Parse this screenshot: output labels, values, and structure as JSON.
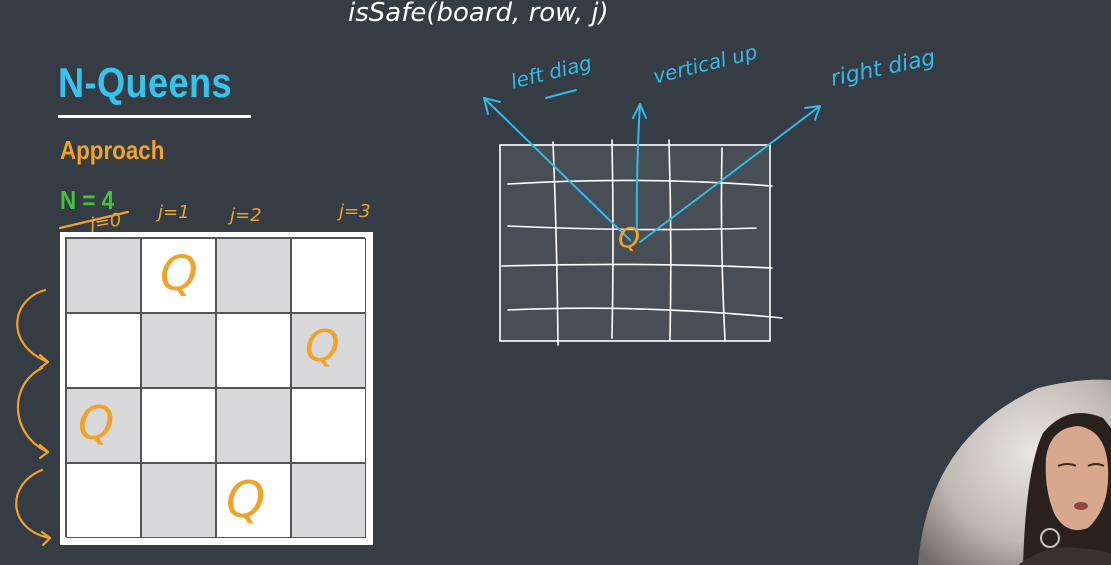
{
  "slide": {
    "title": "N-Queens",
    "subtitle": "Approach",
    "n_label": "N = 4"
  },
  "board": {
    "size": 4,
    "column_labels": [
      "j=0",
      "j=1",
      "j=2",
      "j=3"
    ],
    "queen_symbol": "Q",
    "queen_columns_by_row": [
      1,
      3,
      0,
      2
    ]
  },
  "annotations": {
    "function_call": "isSafe(board, row, j)",
    "left_diag": "left diag",
    "vertical_up": "vertical up",
    "right_diag": "right diag",
    "center_queen": "Q"
  },
  "colors": {
    "background": "#353c43",
    "title": "#36c3ee",
    "subtitle": "#f0a22b",
    "n_label": "#42c53a",
    "ink_blue": "#33b9ea",
    "ink_orange": "#f0a22b",
    "dark_square": "#d8d8da"
  }
}
